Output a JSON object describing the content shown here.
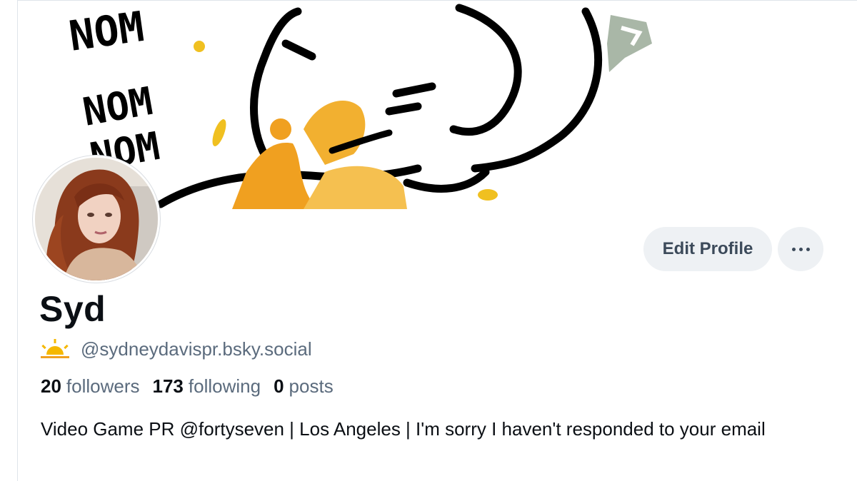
{
  "banner": {
    "art_text": [
      "NOM",
      "NOM NOM",
      "NOM"
    ],
    "icon": "cartoon-art-banner"
  },
  "avatar": {
    "icon": "profile-photo"
  },
  "actions": {
    "edit_label": "Edit Profile",
    "more_icon": "ellipsis-icon"
  },
  "profile": {
    "display_name": "Syd",
    "handle": "@sydneydavispr.bsky.social",
    "handle_icon": "sun-icon",
    "stats": [
      {
        "count": "20",
        "label": "followers"
      },
      {
        "count": "173",
        "label": "following"
      },
      {
        "count": "0",
        "label": "posts"
      }
    ],
    "bio": "Video Game PR @fortyseven | Los Angeles | I'm sorry I haven't responded to your email"
  },
  "colors": {
    "accent_orange": "#f0a020",
    "text_secondary": "#5b6b7d",
    "button_bg": "#eef1f4"
  }
}
